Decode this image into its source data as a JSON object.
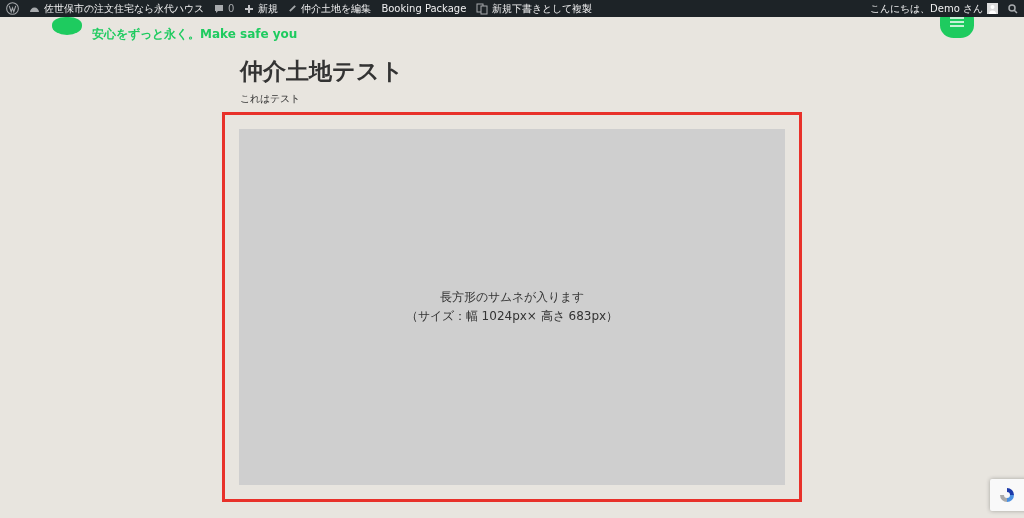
{
  "admin_bar": {
    "site_name": "佐世保市の注文住宅なら永代ハウス",
    "comments": "0",
    "new": "新規",
    "edit": "仲介土地を編集",
    "plugin": "Booking Package",
    "duplicate": "新規下書きとして複製",
    "greeting": "こんにちは、Demo さん"
  },
  "header": {
    "tagline": "安心をずっと永く。Make safe you"
  },
  "page": {
    "title": "仲介土地テスト",
    "subtitle": "これはテスト",
    "thumbnail_lines": [
      "長方形のサムネが入ります",
      "（サイズ：幅 1024px× 高さ 683px）"
    ]
  }
}
